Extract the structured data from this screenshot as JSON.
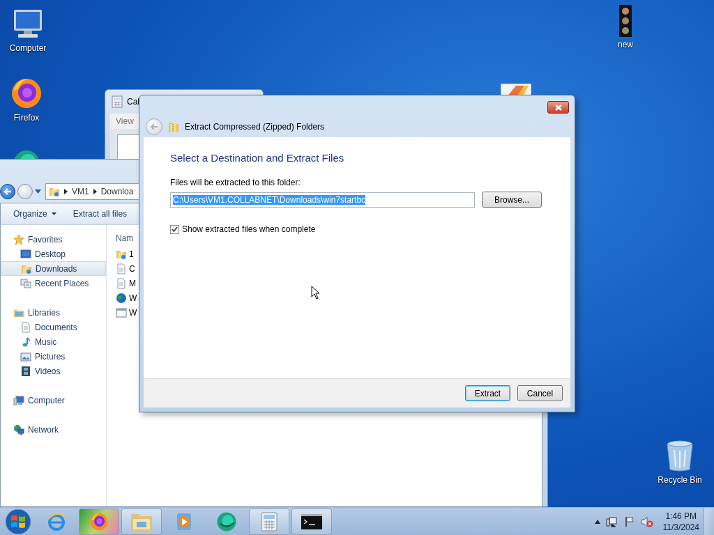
{
  "desktop_icons": [
    {
      "label": "Computer"
    },
    {
      "label": "Firefox"
    },
    {
      "label": "new"
    },
    {
      "label": "Recycle Bin"
    }
  ],
  "calculator_window": {
    "title": "Cal",
    "menu": [
      "View"
    ]
  },
  "explorer_window": {
    "breadcrumb": [
      "VM1",
      "Downloa"
    ],
    "toolbar": [
      {
        "label": "Organize",
        "dropdown": true
      },
      {
        "label": "Extract all files",
        "dropdown": false
      }
    ],
    "navigation": [
      {
        "label": "Favorites",
        "selected": false,
        "children": [
          {
            "label": "Desktop",
            "selected": false
          },
          {
            "label": "Downloads",
            "selected": true
          },
          {
            "label": "Recent Places",
            "selected": false
          }
        ]
      },
      {
        "label": "Libraries",
        "selected": false,
        "children": [
          {
            "label": "Documents",
            "selected": false
          },
          {
            "label": "Music",
            "selected": false
          },
          {
            "label": "Pictures",
            "selected": false
          },
          {
            "label": "Videos",
            "selected": false
          }
        ]
      },
      {
        "label": "Computer",
        "selected": false
      },
      {
        "label": "Network",
        "selected": false
      }
    ],
    "column_header": "Nam",
    "files": [
      {
        "name": "1"
      },
      {
        "name": "C"
      },
      {
        "name": "M"
      },
      {
        "name": "W"
      },
      {
        "name": "W"
      }
    ]
  },
  "dialog": {
    "title": "Extract Compressed (Zipped) Folders",
    "heading": "Select a Destination and Extract Files",
    "field_label": "Files will be extracted to this folder:",
    "path": {
      "value": "C:\\Users\\VM1.COLLABNET\\Downloads\\win7startbc",
      "selected": true
    },
    "browse_button": "Browse...",
    "checkbox": {
      "label": "Show extracted files when complete",
      "checked": true
    },
    "buttons": [
      {
        "label": "Extract",
        "default": true
      },
      {
        "label": "Cancel",
        "default": false
      }
    ]
  },
  "taskbar": {
    "items": [
      {
        "running": false,
        "hovered": false
      },
      {
        "running": true,
        "hovered": true
      },
      {
        "running": true,
        "hovered": false
      },
      {
        "running": false,
        "hovered": false
      },
      {
        "running": false,
        "hovered": false
      },
      {
        "running": true,
        "hovered": false
      },
      {
        "running": true,
        "hovered": false
      }
    ],
    "time": "1:46 PM",
    "date": "11/3/2024"
  }
}
